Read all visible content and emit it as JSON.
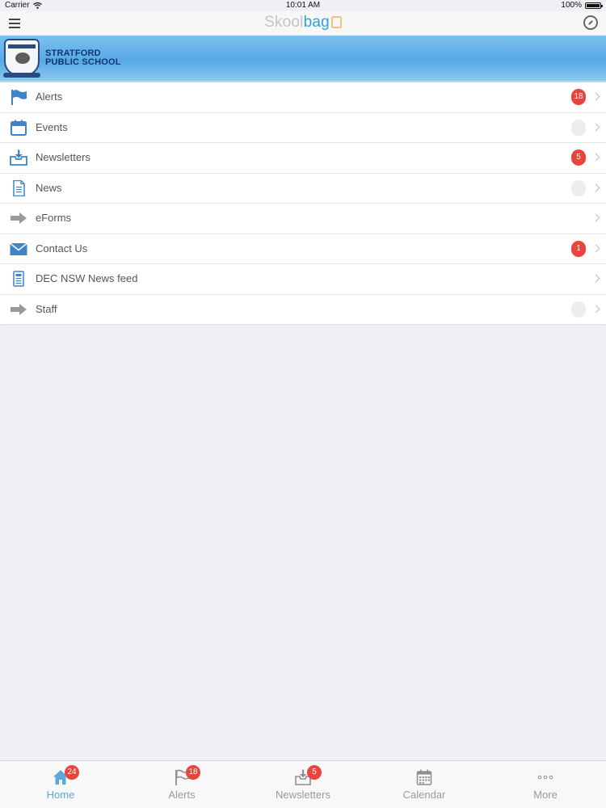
{
  "status_bar": {
    "carrier": "Carrier",
    "time": "10:01 AM",
    "battery": "100%"
  },
  "nav": {
    "logo_part1": "Skool",
    "logo_part2": "bag"
  },
  "school": {
    "name_line1": "STRATFORD",
    "name_line2": "PUBLIC SCHOOL"
  },
  "colors": {
    "accent": "#2fa3d8",
    "badge": "#e8453c",
    "banner": "#56a9e6"
  },
  "menu": [
    {
      "label": "Alerts",
      "icon": "flag-icon",
      "badge": "18"
    },
    {
      "label": "Events",
      "icon": "calendar-icon",
      "badge": ""
    },
    {
      "label": "Newsletters",
      "icon": "inbox-download-icon",
      "badge": "5"
    },
    {
      "label": "News",
      "icon": "document-icon",
      "badge": ""
    },
    {
      "label": "eForms",
      "icon": "arrow-right-icon",
      "badge": null
    },
    {
      "label": "Contact Us",
      "icon": "envelope-icon",
      "badge": "1"
    },
    {
      "label": "DEC NSW News feed",
      "icon": "news-feed-icon",
      "badge": null
    },
    {
      "label": "Staff",
      "icon": "arrow-right-icon",
      "badge": ""
    }
  ],
  "tabs": [
    {
      "label": "Home",
      "icon": "home-icon",
      "badge": "24",
      "active": true
    },
    {
      "label": "Alerts",
      "icon": "flag-icon",
      "badge": "18",
      "active": false
    },
    {
      "label": "Newsletters",
      "icon": "inbox-download-icon",
      "badge": "5",
      "active": false
    },
    {
      "label": "Calendar",
      "icon": "calendar-icon",
      "badge": null,
      "active": false
    },
    {
      "label": "More",
      "icon": "more-dots-icon",
      "badge": null,
      "active": false
    }
  ]
}
